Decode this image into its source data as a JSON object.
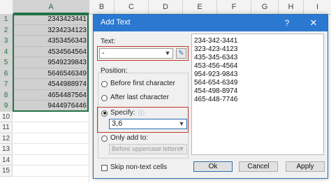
{
  "sheet": {
    "columns": [
      "A",
      "B",
      "C",
      "D",
      "E",
      "F",
      "G",
      "H",
      "I"
    ],
    "rows": [
      "1",
      "2",
      "3",
      "4",
      "5",
      "6",
      "7",
      "8",
      "9",
      "10",
      "11",
      "12",
      "13",
      "14",
      "15"
    ],
    "values": [
      "2343423441",
      "3234234123",
      "4353456343",
      "4534564564",
      "9549239843",
      "5646546349",
      "4544988974",
      "4654487564",
      "9444976446"
    ]
  },
  "dialog": {
    "title": "Add Text",
    "help": "?",
    "close": "✕",
    "text_label": "Text:",
    "text_value": "-",
    "position_label": "Position:",
    "options": {
      "before_first": "Before first character",
      "after_last": "After last character",
      "specify": "Specify:",
      "only_add_to": "Only add to:"
    },
    "specify_value": "3,6",
    "only_add_to_value": "Before uppercase letters",
    "skip_label": "Skip non-text cells",
    "preview_lines": [
      "234-342-3441",
      "323-423-4123",
      "435-345-6343",
      "453-456-4564",
      "954-923-9843",
      "564-654-6349",
      "454-498-8974",
      "465-448-7746"
    ],
    "buttons": {
      "ok": "Ok",
      "cancel": "Cancel",
      "apply": "Apply"
    }
  },
  "colors": {
    "title_bar": "#2b78d1",
    "excel_green": "#217346",
    "highlight_red": "#c0392b"
  }
}
